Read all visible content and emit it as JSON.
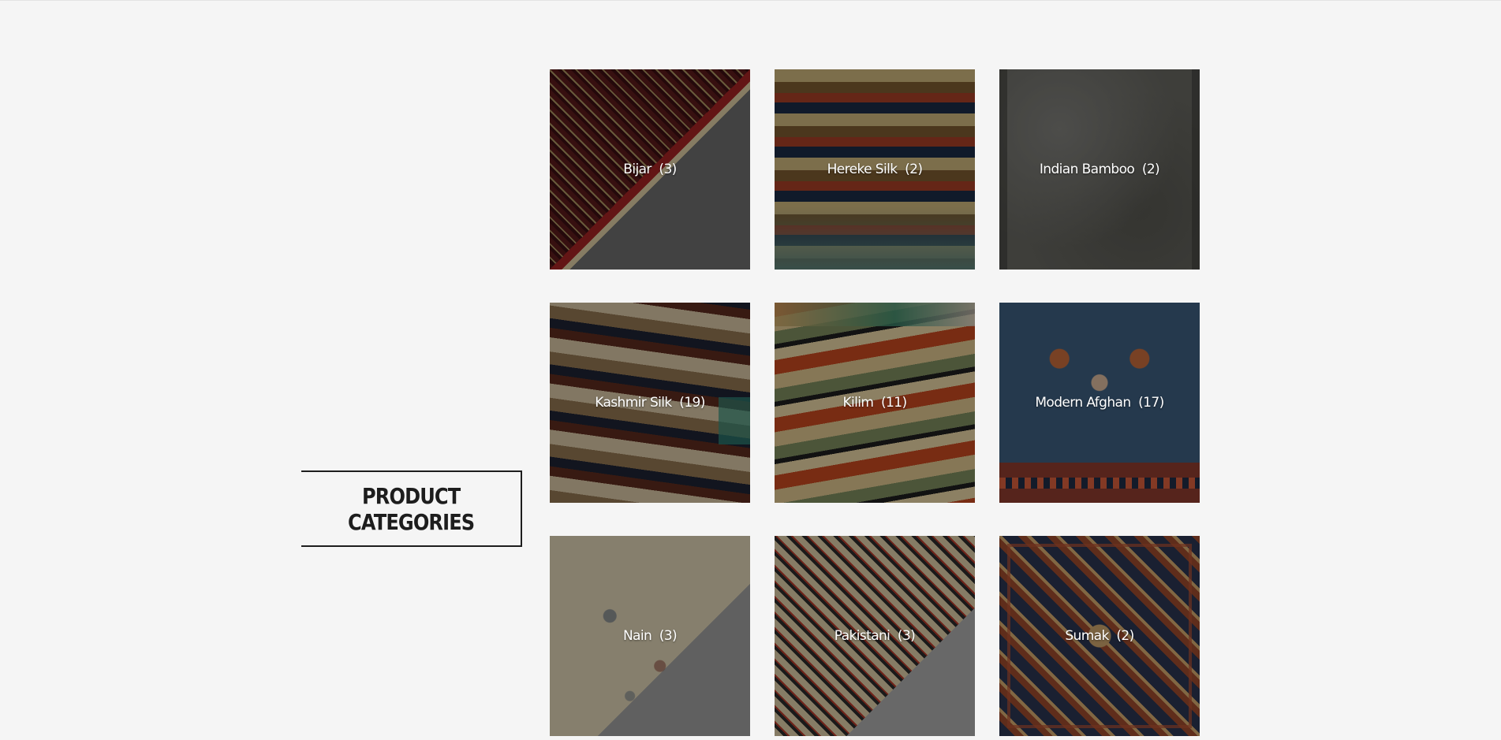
{
  "section": {
    "heading": "PRODUCT\nCATEGORIES"
  },
  "categories": [
    {
      "label": "Bijar  (3)",
      "name": "Bijar",
      "count": 3
    },
    {
      "label": "Hereke Silk  (2)",
      "name": "Hereke Silk",
      "count": 2
    },
    {
      "label": "Indian Bamboo  (2)",
      "name": "Indian Bamboo",
      "count": 2
    },
    {
      "label": "Kashmir Silk  (19)",
      "name": "Kashmir Silk",
      "count": 19
    },
    {
      "label": "Kilim  (11)",
      "name": "Kilim",
      "count": 11
    },
    {
      "label": "Modern Afghan  (17)",
      "name": "Modern Afghan",
      "count": 17
    },
    {
      "label": "Nain  (3)",
      "name": "Nain",
      "count": 3
    },
    {
      "label": "Pakistani  (3)",
      "name": "Pakistani",
      "count": 3
    },
    {
      "label": "Sumak  (2)",
      "name": "Sumak",
      "count": 2
    }
  ]
}
